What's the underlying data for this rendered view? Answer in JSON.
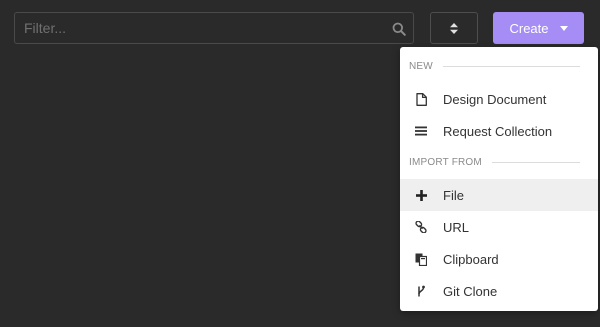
{
  "filter": {
    "placeholder": "Filter..."
  },
  "toolbar": {
    "create_label": "Create"
  },
  "menu": {
    "new_header": "NEW",
    "import_header": "IMPORT FROM",
    "new_items": [
      {
        "label": "Design Document",
        "icon": "document-icon"
      },
      {
        "label": "Request Collection",
        "icon": "hamburger-list-icon"
      }
    ],
    "import_items": [
      {
        "label": "File",
        "icon": "plus-icon"
      },
      {
        "label": "URL",
        "icon": "link-icon"
      },
      {
        "label": "Clipboard",
        "icon": "clipboard-icon"
      },
      {
        "label": "Git Clone",
        "icon": "git-branch-icon"
      }
    ]
  },
  "colors": {
    "background": "#2a2a2a",
    "accent": "#a58df5",
    "menu_background": "#ffffff",
    "hover_row": "#efefef"
  }
}
